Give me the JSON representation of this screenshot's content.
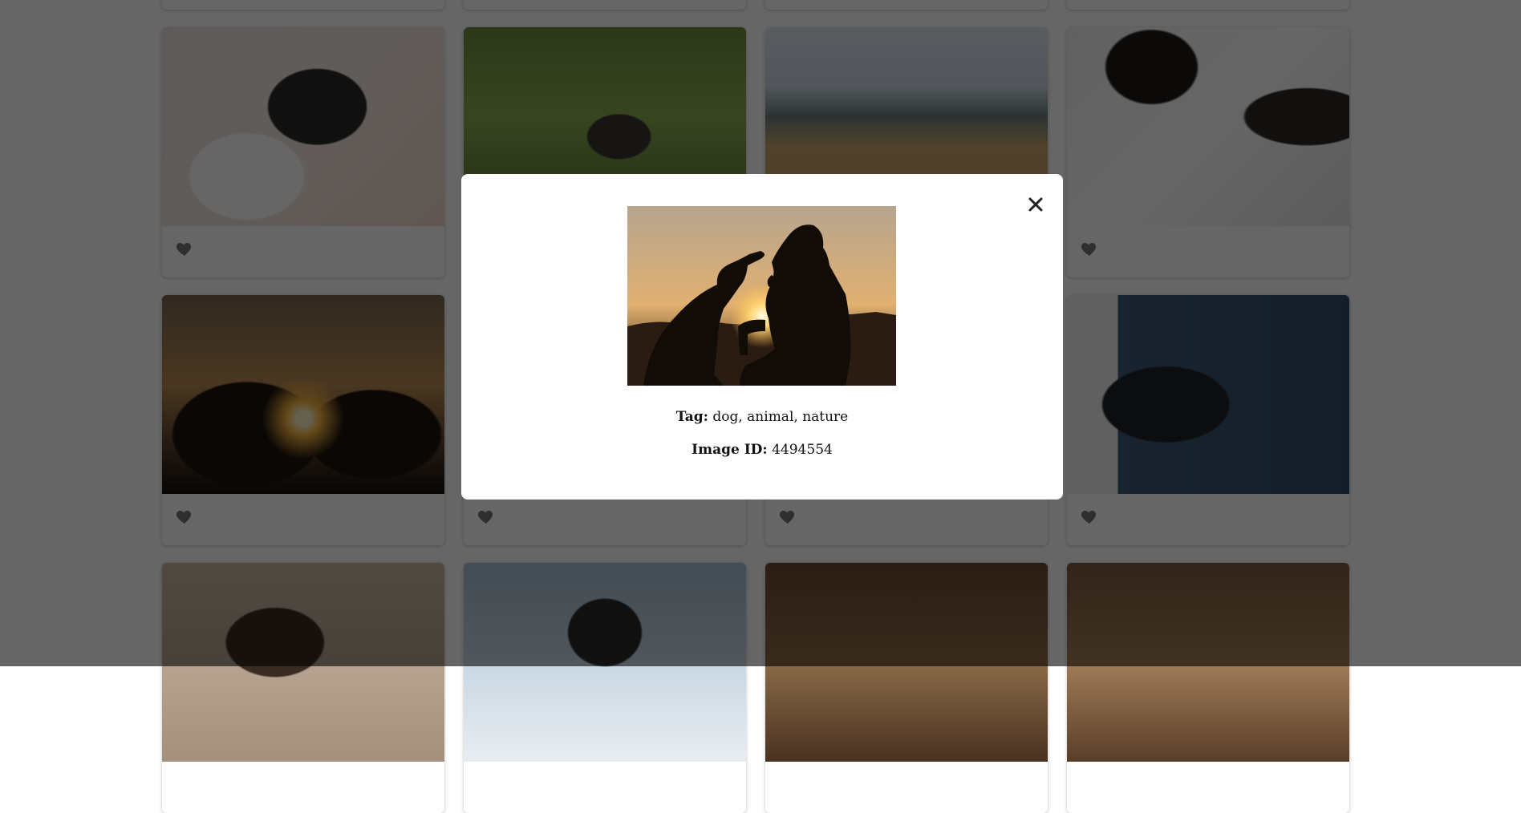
{
  "modal": {
    "tag_label": "Tag:",
    "tag_value": "dog, animal, nature",
    "id_label": "Image ID:",
    "id_value": "4494554",
    "close_icon": "close-icon"
  },
  "gallery": {
    "favorite_icon": "heart-icon"
  },
  "colors": {
    "overlay": "#00000099",
    "modal_bg": "#ffffff",
    "text": "#111111"
  }
}
